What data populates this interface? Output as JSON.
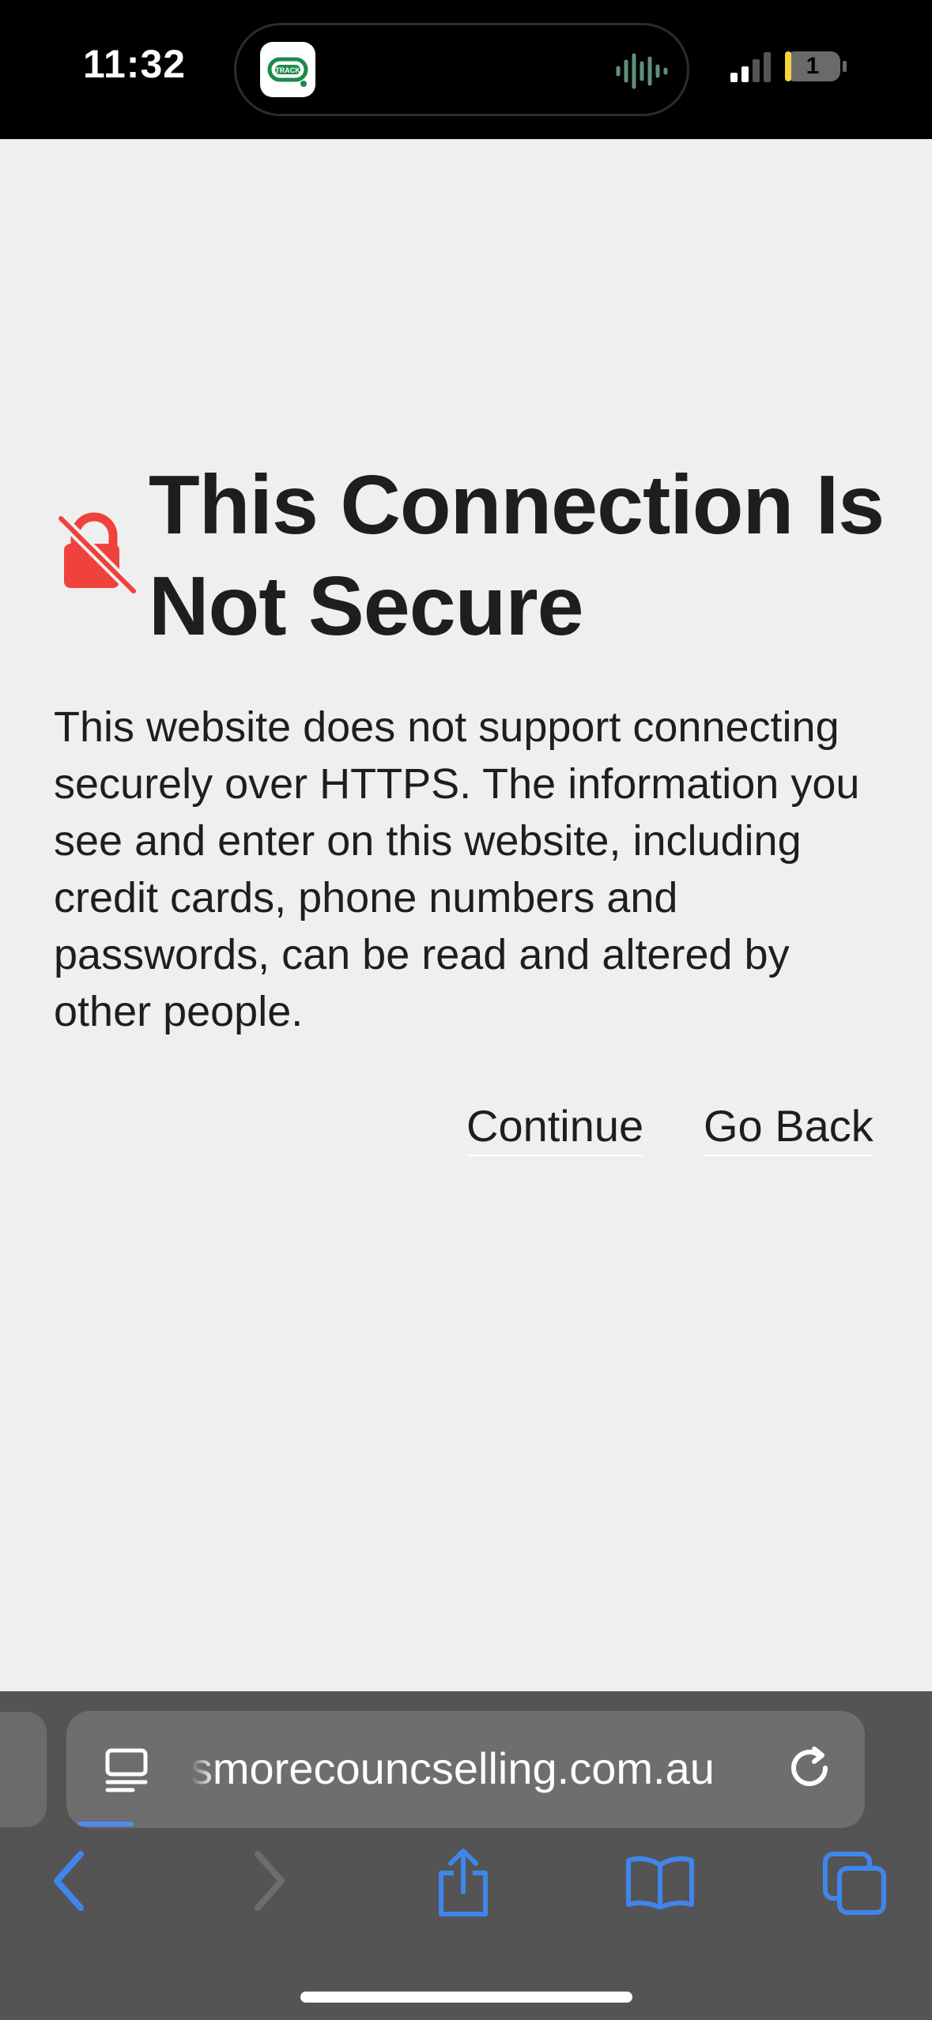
{
  "status_bar": {
    "time": "11:32",
    "live_activity_app": "TRACK",
    "notification_count": "1"
  },
  "warning": {
    "title": "This Connection Is Not Secure",
    "message": "This website does not support connecting securely over HTTPS. The information you see and enter on this website, including credit cards, phone numbers and passwords, can be read and altered by other people.",
    "continue_label": "Continue",
    "go_back_label": "Go Back"
  },
  "browser": {
    "url": "lismorecouncselling.com.au",
    "load_progress": 0.07
  },
  "icons": {
    "lock": "lock-slash-icon",
    "page_menu": "page-menu-icon",
    "reload": "reload-icon",
    "back": "chevron-left-icon",
    "forward": "chevron-right-icon",
    "share": "share-icon",
    "bookmarks": "book-icon",
    "tabs": "tabs-icon"
  },
  "colors": {
    "accent": "#4a8df0",
    "warning_red": "#f0423c",
    "background": "#efefef",
    "chrome": "#545454"
  }
}
